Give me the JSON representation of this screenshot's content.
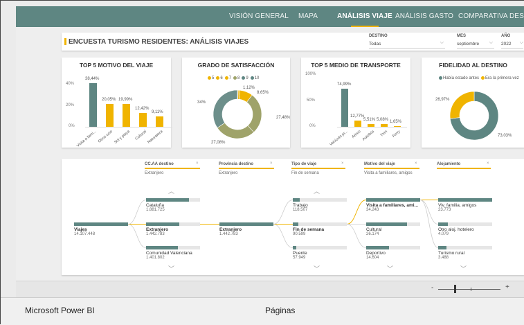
{
  "colors": {
    "teal": "#5e8682",
    "gold": "#f0b400",
    "olive": "#9fa36a",
    "dkteal": "#6d8f8b"
  },
  "nav": [
    "VISIÓN GENERAL",
    "MAPA",
    "ANÁLISIS VIAJE",
    "ANÁLISIS GASTO",
    "COMPARATIVA DESTINOS"
  ],
  "header": {
    "title": "ENCUESTA TURISMO RESIDENTES: ANÁLISIS VIAJES",
    "destino_label": "DESTINO",
    "destino_value": "Todas",
    "mes_label": "MES",
    "mes_value": "septiembre",
    "anio_label": "AÑO",
    "anio_value": "2022"
  },
  "motivo": {
    "title": "TOP 5 MOTIVO DEL VIAJE",
    "ticks": [
      "40%",
      "20%",
      "0%"
    ],
    "chart_data": {
      "type": "bar",
      "categories": [
        "Visita a fami...",
        "Otros ocio",
        "Sol y playa",
        "Cultural",
        "Naturaleza"
      ],
      "values": [
        38.44,
        20.05,
        19.99,
        12.42,
        9.11
      ],
      "labels": [
        "38,44%",
        "20,05%",
        "19,99%",
        "12,42%",
        "9,11%"
      ],
      "ylim": [
        0,
        50
      ]
    }
  },
  "satisf": {
    "title": "GRADO DE SATISFACCIÓN",
    "legend": [
      "5",
      "6",
      "7",
      "8",
      "9",
      "10"
    ],
    "chart_data": {
      "type": "pie",
      "labels": [
        "5",
        "6",
        "7",
        "8",
        "9",
        "10"
      ],
      "values": [
        0.5,
        1.12,
        8.65,
        27.48,
        27.08,
        34
      ],
      "value_labels": [
        "",
        "1,12%",
        "8,65%",
        "27,48%",
        "27,08%",
        "34%"
      ]
    }
  },
  "transporte": {
    "title": "TOP 5 MEDIO DE TRANSPORTE",
    "ticks": [
      "100%",
      "50%",
      "0%"
    ],
    "chart_data": {
      "type": "bar",
      "categories": [
        "Vehículo pr...",
        "Aéreo",
        "Autobús",
        "Tren",
        "Ferry"
      ],
      "values": [
        74.99,
        12.77,
        5.51,
        5.08,
        1.65
      ],
      "labels": [
        "74,99%",
        "12,77%",
        "5,51%",
        "5,08%",
        "1,65%"
      ],
      "ylim": [
        0,
        110
      ]
    }
  },
  "fidelidad": {
    "title": "FIDELIDAD AL DESTINO",
    "legend": [
      "Había estado antes",
      "Era la primera vez"
    ],
    "chart_data": {
      "type": "pie",
      "labels": [
        "Había estado antes",
        "Era la primera vez"
      ],
      "values": [
        73.03,
        26.97
      ],
      "value_labels": [
        "73,03%",
        "26,97%"
      ]
    }
  },
  "tree": {
    "filters": [
      {
        "hdr": "CC.AA destino",
        "sub": "Extranjero"
      },
      {
        "hdr": "Provincia destino",
        "sub": "Extranjero"
      },
      {
        "hdr": "Tipo de viaje",
        "sub": "Fin de semana"
      },
      {
        "hdr": "Motivo del viaje",
        "sub": "Visita a familiares, amigos"
      },
      {
        "hdr": "Alojamiento",
        "sub": ""
      }
    ],
    "root": {
      "name": "Viajes",
      "value": "14.107.448"
    },
    "ccaa": [
      {
        "name": "Cataluña",
        "value": "1.881.725"
      },
      {
        "name": "Extranjero",
        "value": "1.442.783"
      },
      {
        "name": "Comunidad Valenciana",
        "value": "1.401.802"
      }
    ],
    "provincia": [
      {
        "name": "Extranjero",
        "value": "1.442.783"
      }
    ],
    "tipo": [
      {
        "name": "Trabajo",
        "value": "118.507"
      },
      {
        "name": "Fin de semana",
        "value": "90.599"
      },
      {
        "name": "Puente",
        "value": "57.949"
      }
    ],
    "motivo": [
      {
        "name": "Visita a familiares, ami...",
        "value": "34.243"
      },
      {
        "name": "Cultural",
        "value": "26.174"
      },
      {
        "name": "Deportivo",
        "value": "14.604"
      }
    ],
    "aloj": [
      {
        "name": "Viv. familia, amigos",
        "value": "23.773"
      },
      {
        "name": "Otro aloj. hotelero",
        "value": "4.079"
      },
      {
        "name": "Turismo rural",
        "value": "3.488"
      }
    ]
  },
  "zoom": {
    "minus": "-",
    "plus": "+"
  },
  "status": {
    "brand": "Microsoft Power BI",
    "pages": "Páginas"
  }
}
